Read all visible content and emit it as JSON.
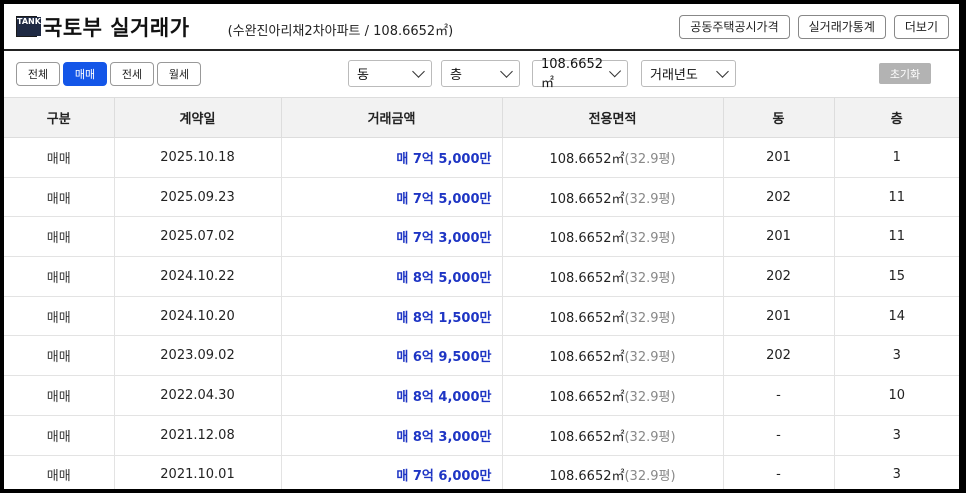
{
  "header": {
    "logo_letters": [
      "TA",
      "NK"
    ],
    "title": "국토부 실거래가",
    "subtitle": "(수완진아리채2차아파트 / 108.6652㎡)",
    "buttons": [
      "공동주택공시가격",
      "실거래가통계",
      "더보기"
    ]
  },
  "filters": {
    "trade_types": [
      {
        "label": "전체",
        "active": false
      },
      {
        "label": "매매",
        "active": true
      },
      {
        "label": "전세",
        "active": false
      },
      {
        "label": "월세",
        "active": false
      }
    ],
    "dong_select": "동",
    "floor_select": "층",
    "area_select": "108.6652㎡",
    "year_select": "거래년도",
    "reset_label": "초기화"
  },
  "table": {
    "columns": [
      "구분",
      "계약일",
      "거래금액",
      "전용면적",
      "동",
      "층"
    ],
    "rows": [
      {
        "kind": "매매",
        "date": "2025.10.18",
        "price": "매 7억 5,000만",
        "area": "108.6652㎡",
        "pyeong": "(32.9평)",
        "dong": "201",
        "floor": "1"
      },
      {
        "kind": "매매",
        "date": "2025.09.23",
        "price": "매 7억 5,000만",
        "area": "108.6652㎡",
        "pyeong": "(32.9평)",
        "dong": "202",
        "floor": "11"
      },
      {
        "kind": "매매",
        "date": "2025.07.02",
        "price": "매 7억 3,000만",
        "area": "108.6652㎡",
        "pyeong": "(32.9평)",
        "dong": "201",
        "floor": "11"
      },
      {
        "kind": "매매",
        "date": "2024.10.22",
        "price": "매 8억 5,000만",
        "area": "108.6652㎡",
        "pyeong": "(32.9평)",
        "dong": "202",
        "floor": "15"
      },
      {
        "kind": "매매",
        "date": "2024.10.20",
        "price": "매 8억 1,500만",
        "area": "108.6652㎡",
        "pyeong": "(32.9평)",
        "dong": "201",
        "floor": "14"
      },
      {
        "kind": "매매",
        "date": "2023.09.02",
        "price": "매 6억 9,500만",
        "area": "108.6652㎡",
        "pyeong": "(32.9평)",
        "dong": "202",
        "floor": "3"
      },
      {
        "kind": "매매",
        "date": "2022.04.30",
        "price": "매 8억 4,000만",
        "area": "108.6652㎡",
        "pyeong": "(32.9평)",
        "dong": "-",
        "floor": "10"
      },
      {
        "kind": "매매",
        "date": "2021.12.08",
        "price": "매 8억 3,000만",
        "area": "108.6652㎡",
        "pyeong": "(32.9평)",
        "dong": "-",
        "floor": "3"
      },
      {
        "kind": "매매",
        "date": "2021.10.01",
        "price": "매 7억 6,000만",
        "area": "108.6652㎡",
        "pyeong": "(32.9평)",
        "dong": "-",
        "floor": "3"
      }
    ]
  },
  "colors": {
    "accent": "#1456e8",
    "price": "#1e35c4",
    "header_bg": "#f2f2f2"
  }
}
